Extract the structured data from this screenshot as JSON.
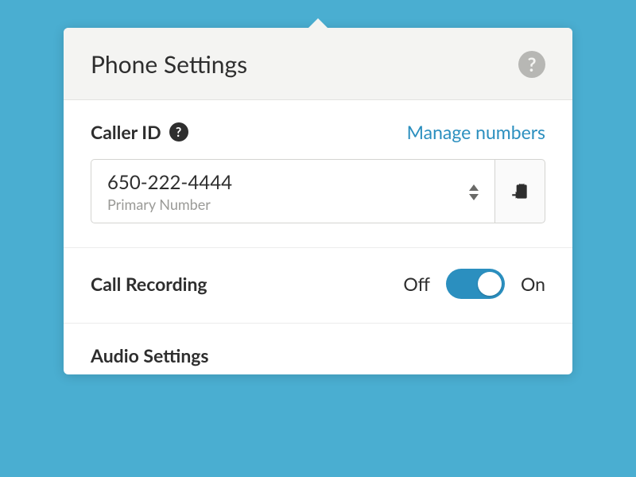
{
  "header": {
    "title": "Phone Settings"
  },
  "callerId": {
    "label": "Caller ID",
    "manage_link": "Manage numbers",
    "number": "650-222-4444",
    "number_label": "Primary Number"
  },
  "callRecording": {
    "label": "Call Recording",
    "off": "Off",
    "on": "On",
    "state": "on"
  },
  "audio": {
    "label": "Audio Settings"
  }
}
